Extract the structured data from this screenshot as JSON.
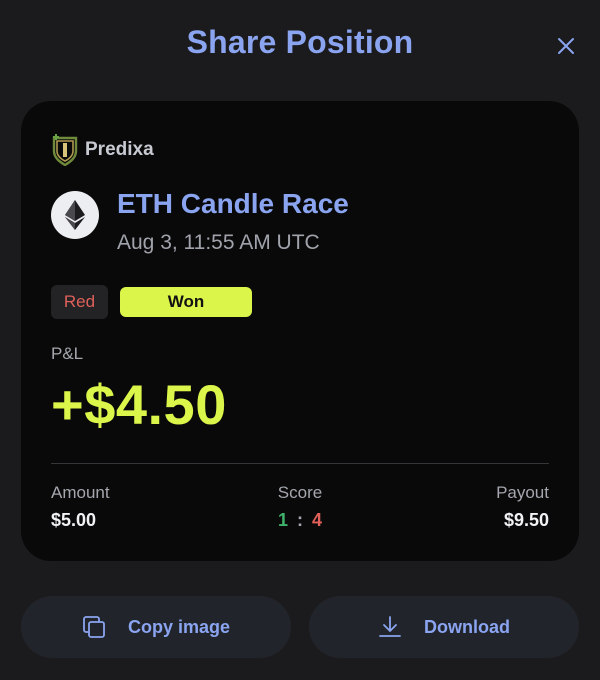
{
  "dialog": {
    "title": "Share Position",
    "close_icon": "close-icon"
  },
  "card": {
    "brand": {
      "name": "Predixa",
      "logo_icon": "predixa-shield-logo"
    },
    "market": {
      "icon": "ethereum-icon",
      "title": "ETH Candle Race",
      "time": "Aug 3, 11:55 AM UTC"
    },
    "side_label": "Red",
    "result_label": "Won",
    "pnl": {
      "label": "P&L",
      "value": "+$4.50"
    },
    "stats": {
      "amount": {
        "label": "Amount",
        "value": "$5.00"
      },
      "score": {
        "label": "Score",
        "home": "1",
        "separator": ":",
        "away": "4"
      },
      "payout": {
        "label": "Payout",
        "value": "$9.50"
      }
    }
  },
  "actions": {
    "copy": {
      "label": "Copy image",
      "icon": "copy-icon"
    },
    "download": {
      "label": "Download",
      "icon": "download-icon"
    }
  },
  "colors": {
    "accent": "#8aa4f0",
    "win": "#dcf54a",
    "red": "#e0605a",
    "green": "#3fb36b",
    "background": "#1b1b1d",
    "card": "#09090a"
  }
}
